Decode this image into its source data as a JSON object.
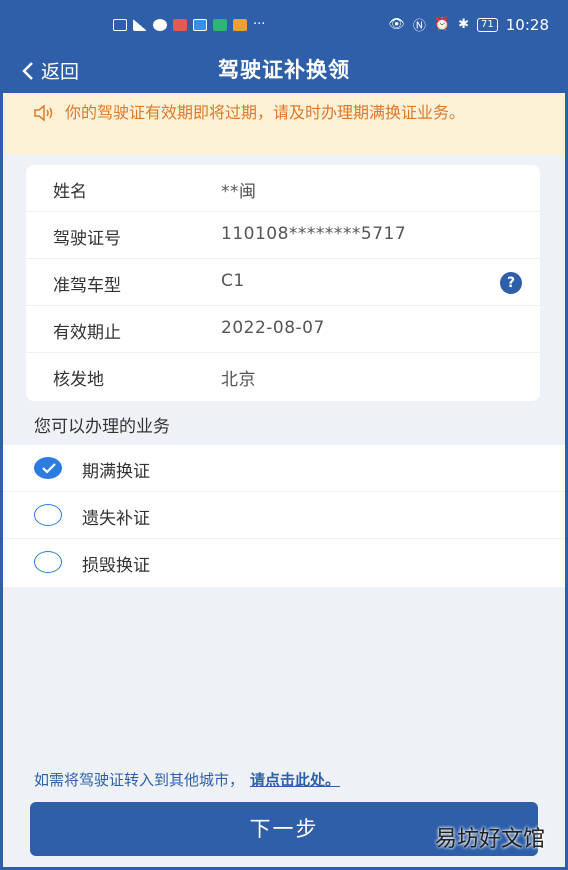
{
  "status_bar": {
    "left_icons": [
      "hd-icon",
      "signal-icon",
      "chat-icon",
      "app-icon",
      "app-icon",
      "app-icon",
      "app-icon"
    ],
    "more": "···",
    "battery": "71",
    "time": "10:28"
  },
  "header": {
    "back_label": "返回",
    "title": "驾驶证补换领"
  },
  "notice": {
    "text": "你的驾驶证有效期即将过期，请及时办理期满换证业务。"
  },
  "info": [
    {
      "label": "姓名",
      "value": "**闽"
    },
    {
      "label": "驾驶证号",
      "value": "110108********5717"
    },
    {
      "label": "准驾车型",
      "value": "C1",
      "help": "?"
    },
    {
      "label": "有效期止",
      "value": "2022-08-07"
    },
    {
      "label": "核发地",
      "value": "北京"
    }
  ],
  "section_title": "您可以办理的业务",
  "options": [
    {
      "label": "期满换证",
      "checked": true
    },
    {
      "label": "遗失补证",
      "checked": false
    },
    {
      "label": "损毁换证",
      "checked": false
    }
  ],
  "transfer": {
    "text": "如需将驾驶证转入到其他城市，",
    "link": "请点击此处。"
  },
  "next_button": "下一步",
  "watermark": "易坊好文馆",
  "colors": {
    "primary": "#2e5fa8",
    "notice_bg": "#fdf1d6",
    "notice_text": "#e0782a",
    "radio": "#2e7be0"
  }
}
